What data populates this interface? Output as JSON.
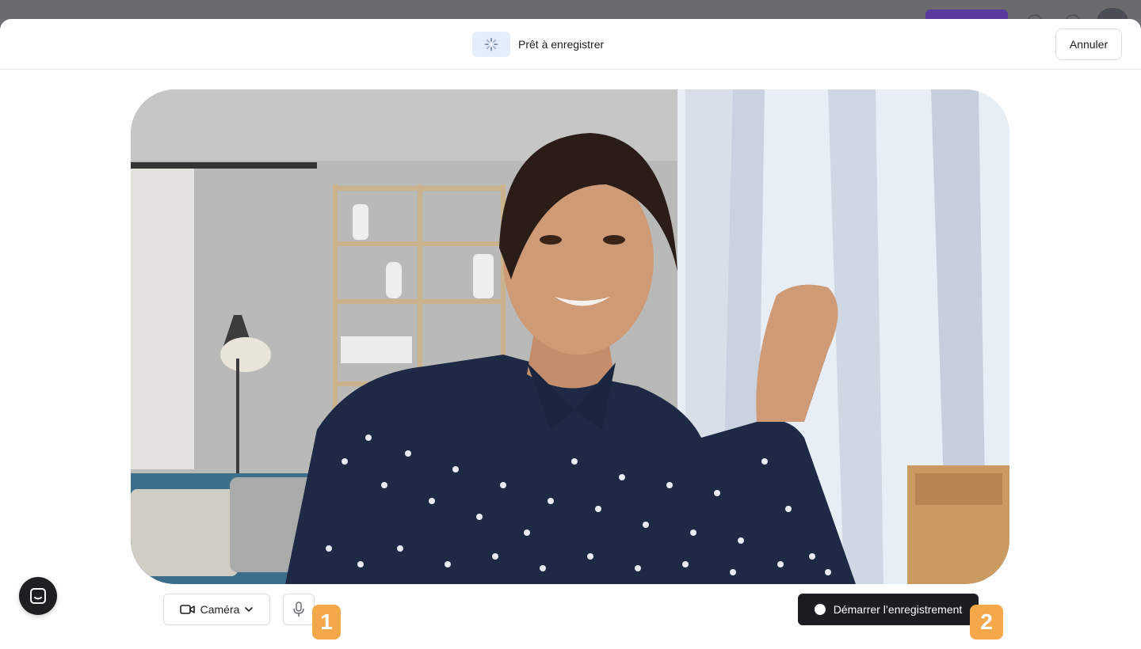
{
  "header": {
    "status_text": "Prêt à enregistrer",
    "status_icon": "spinner-icon",
    "cancel_label": "Annuler"
  },
  "controls": {
    "camera_label": "Caméra",
    "camera_icon": "video-camera-icon",
    "mic_icon": "microphone-icon",
    "record_label": "Démarrer l’enregistrement"
  },
  "steps": {
    "step1": "1",
    "step2": "2"
  },
  "colors": {
    "accent_badge": "#f4a84a",
    "record_button": "#1c1c22",
    "status_bg": "#e4edfb"
  }
}
